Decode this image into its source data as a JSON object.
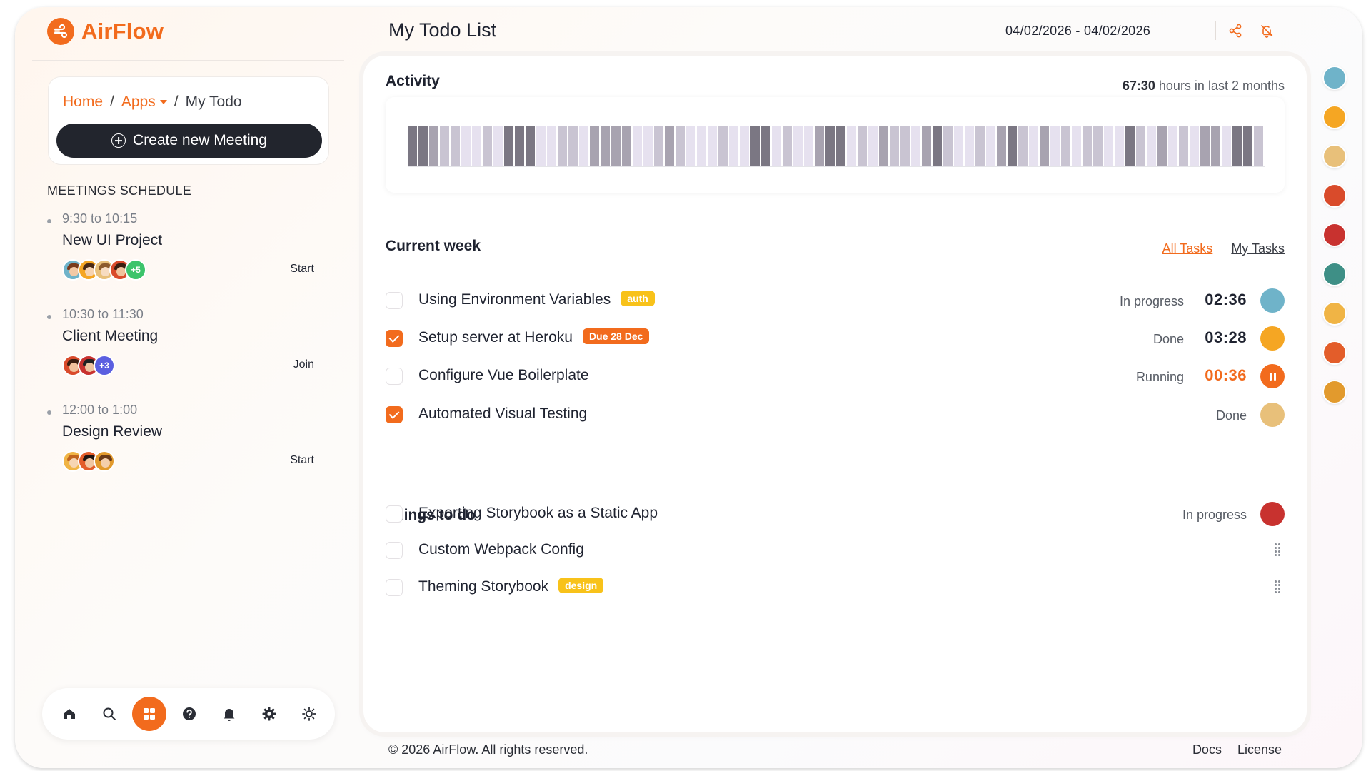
{
  "app": {
    "name": "AirFlow"
  },
  "breadcrumb": {
    "home": "Home",
    "apps": "Apps",
    "current": "My Todo",
    "separator": "/"
  },
  "create_meeting_label": "Create new Meeting",
  "schedule": {
    "title": "MEETINGS SCHEDULE",
    "meetings": [
      {
        "time": "9:30 to 10:15",
        "title": "New UI Project",
        "action": "Start",
        "more": "+5",
        "more_color": "#3cc46b"
      },
      {
        "time": "10:30 to 11:30",
        "title": "Client Meeting",
        "action": "Join",
        "more": "+3",
        "more_color": "#5b5fe0"
      },
      {
        "time": "12:00 to 1:00",
        "title": "Design Review",
        "action": "Start",
        "more": ""
      }
    ]
  },
  "bottom_nav": [
    "home-icon",
    "search-icon",
    "apps-grid-icon",
    "help-icon",
    "bell-icon",
    "gear-icon",
    "sun-icon"
  ],
  "header": {
    "title": "My Todo List",
    "date_range": "04/02/2026 - 04/02/2026"
  },
  "activity": {
    "title": "Activity",
    "hours_value": "67:30",
    "hours_suffix": "hours in last 2 months",
    "levels": [
      3,
      3,
      2,
      1,
      1,
      0,
      0,
      1,
      0,
      3,
      3,
      3,
      0,
      0,
      1,
      1,
      0,
      2,
      2,
      2,
      2,
      0,
      0,
      1,
      2,
      1,
      0,
      0,
      0,
      1,
      0,
      0,
      3,
      3,
      0,
      1,
      0,
      0,
      2,
      3,
      3,
      0,
      1,
      0,
      2,
      1,
      1,
      0,
      2,
      3,
      1,
      0,
      0,
      1,
      0,
      2,
      3,
      1,
      0,
      2,
      0,
      1,
      0,
      1,
      1,
      0,
      0,
      3,
      1,
      0,
      2,
      0,
      1,
      0,
      2,
      2,
      0,
      3,
      3,
      1
    ]
  },
  "current_week": {
    "title": "Current week",
    "links": {
      "all": "All Tasks",
      "mine": "My Tasks"
    },
    "tasks": [
      {
        "name": "Using Environment Variables",
        "tag": "auth",
        "tag_color": "yellow",
        "checked": false,
        "status": "In progress",
        "time": "02:36",
        "running": false
      },
      {
        "name": "Setup server at Heroku",
        "tag": "Due 28 Dec",
        "tag_color": "orange",
        "checked": true,
        "status": "Done",
        "time": "03:28",
        "running": false
      },
      {
        "name": "Configure Vue Boilerplate",
        "tag": "",
        "checked": false,
        "status": "Running",
        "time": "00:36",
        "running": true
      },
      {
        "name": "Automated Visual Testing",
        "tag": "",
        "checked": true,
        "status": "Done",
        "time": "",
        "running": false
      }
    ]
  },
  "things_to_do": {
    "title": "Things to do",
    "tasks": [
      {
        "name": "Exporting Storybook as a Static App",
        "tag": "",
        "checked": false,
        "status": "In progress"
      },
      {
        "name": "Custom Webpack Config",
        "tag": "",
        "checked": false,
        "status": ""
      },
      {
        "name": "Theming Storybook",
        "tag": "design",
        "tag_color": "yellow",
        "checked": false,
        "status": ""
      }
    ]
  },
  "footer": {
    "copyright": "© 2026 AirFlow. All rights reserved.",
    "docs": "Docs",
    "license": "License"
  },
  "colors": {
    "accent": "#f26b1d",
    "dark": "#22252d",
    "bar_levels": [
      "#e6e1ef",
      "#c9c4d2",
      "#a8a3b0",
      "#7b7783"
    ]
  }
}
